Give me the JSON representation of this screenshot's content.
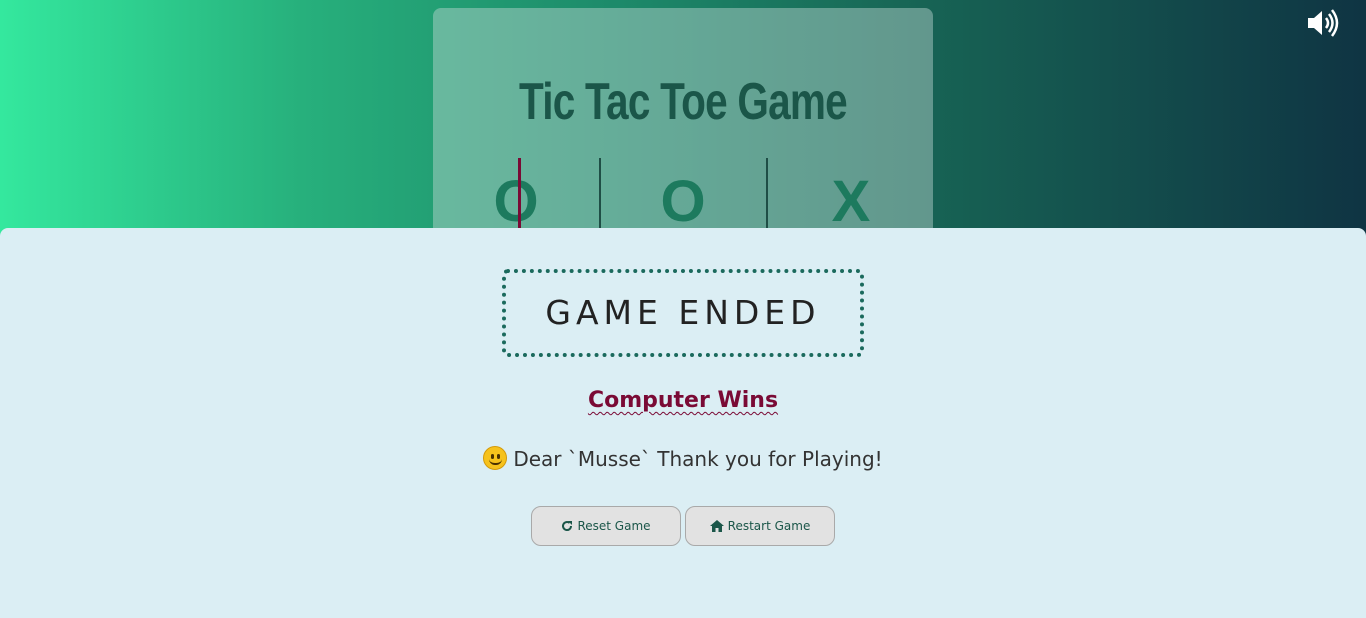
{
  "game": {
    "title": "Tic Tac Toe Game",
    "cells": [
      "O",
      "O",
      "X"
    ]
  },
  "modal": {
    "status": "GAME ENDED",
    "winner": "Computer Wins",
    "message": "Dear `Musse` Thank you for Playing!",
    "emoji_icon": "smiley-icon"
  },
  "buttons": {
    "reset_label": "Reset Game",
    "reset_icon": "refresh-icon",
    "restart_label": "Restart Game",
    "restart_icon": "home-icon"
  },
  "sound_icon": "volume-up-icon",
  "colors": {
    "gradient_start": "#34e89e",
    "gradient_end": "#0f3443",
    "title": "#1b5649",
    "mark": "#1d7a5e",
    "winner": "#7a0a35",
    "modal_bg": "#dbeef4",
    "status_border": "#1b6a5d"
  }
}
